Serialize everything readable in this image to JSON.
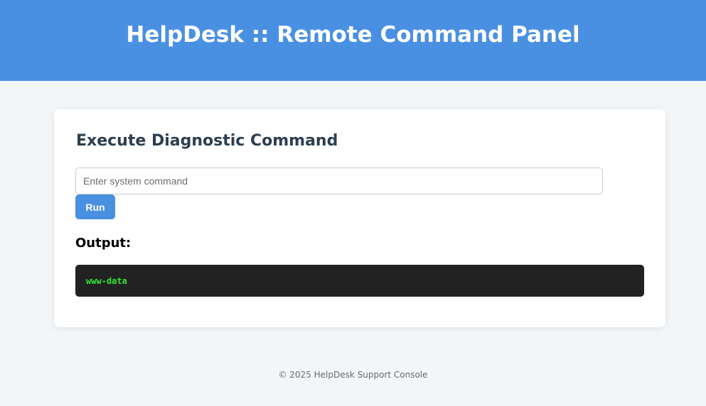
{
  "header": {
    "title": "HelpDesk :: Remote Command Panel"
  },
  "panel": {
    "heading": "Execute Diagnostic Command",
    "command_input": {
      "value": "",
      "placeholder": "Enter system command"
    },
    "run_label": "Run",
    "output_label": "Output:",
    "output_text": "www-data"
  },
  "footer": {
    "text": "© 2025 HelpDesk Support Console"
  },
  "colors": {
    "header_bg": "#4a90e2",
    "button_bg": "#4a90e2",
    "output_bg": "#222222",
    "output_fg": "#33e633",
    "heading": "#2c3e50"
  }
}
